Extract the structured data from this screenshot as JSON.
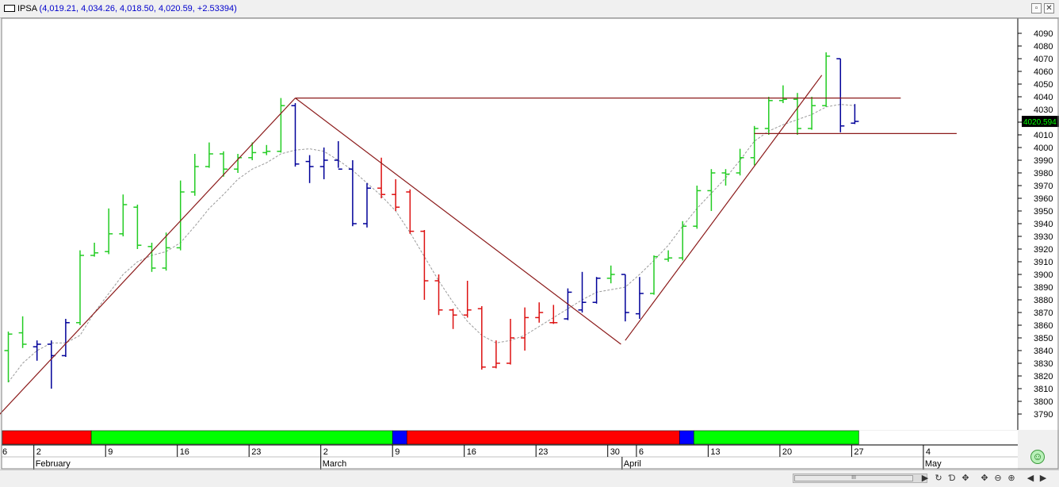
{
  "window": {
    "symbol": "IPSA",
    "quote": "(4,019.21, 4,034.26, 4,018.50, 4,020.59, +2.53394)",
    "restore_icon": "restore-icon",
    "close_icon": "close-icon"
  },
  "chart_data": {
    "type": "ohlc",
    "ylim": [
      3785,
      4100
    ],
    "yticks": [
      3790,
      3800,
      3810,
      3820,
      3830,
      3840,
      3850,
      3860,
      3870,
      3880,
      3890,
      3900,
      3910,
      3920,
      3930,
      3940,
      3950,
      3960,
      3970,
      3980,
      3990,
      4000,
      4010,
      4020,
      4030,
      4040,
      4050,
      4060,
      4070,
      4080,
      4090
    ],
    "last_price_label": "4020.594",
    "date_ticks": [
      {
        "i": 2,
        "label": "2"
      },
      {
        "i": 7,
        "label": "9"
      },
      {
        "i": 12,
        "label": "16"
      },
      {
        "i": 17,
        "label": "23"
      },
      {
        "i": 22,
        "label": "2"
      },
      {
        "i": 27,
        "label": "9"
      },
      {
        "i": 32,
        "label": "16"
      },
      {
        "i": 37,
        "label": "23"
      },
      {
        "i": 42,
        "label": "30"
      },
      {
        "i": 44,
        "label": "6"
      },
      {
        "i": 49,
        "label": "13"
      },
      {
        "i": 54,
        "label": "20"
      },
      {
        "i": 59,
        "label": "27"
      },
      {
        "i": 64,
        "label": "4"
      }
    ],
    "left_edge_label": "6",
    "months": [
      {
        "i": 2,
        "label": "February"
      },
      {
        "i": 22,
        "label": "March"
      },
      {
        "i": 43,
        "label": "April"
      },
      {
        "i": 64,
        "label": "May"
      }
    ],
    "colors": {
      "up": "#22cc22",
      "down": "#dd1111",
      "neutral": "#000099",
      "ma": "#9a9a9a",
      "trend": "#8b1a1a"
    },
    "bars": [
      {
        "o": 3840,
        "h": 3855,
        "l": 3815,
        "c": 3853,
        "s": "up"
      },
      {
        "o": 3854,
        "h": 3867,
        "l": 3842,
        "c": 3845,
        "s": "up"
      },
      {
        "o": 3843,
        "h": 3848,
        "l": 3832,
        "c": 3845,
        "s": "neutral"
      },
      {
        "o": 3845,
        "h": 3848,
        "l": 3810,
        "c": 3836,
        "s": "neutral"
      },
      {
        "o": 3836,
        "h": 3865,
        "l": 3835,
        "c": 3862,
        "s": "neutral"
      },
      {
        "o": 3862,
        "h": 3919,
        "l": 3860,
        "c": 3915,
        "s": "up"
      },
      {
        "o": 3915,
        "h": 3925,
        "l": 3914,
        "c": 3917,
        "s": "up"
      },
      {
        "o": 3918,
        "h": 3952,
        "l": 3916,
        "c": 3932,
        "s": "up"
      },
      {
        "o": 3932,
        "h": 3963,
        "l": 3930,
        "c": 3955,
        "s": "up"
      },
      {
        "o": 3953,
        "h": 3955,
        "l": 3920,
        "c": 3923,
        "s": "up"
      },
      {
        "o": 3922,
        "h": 3925,
        "l": 3902,
        "c": 3905,
        "s": "up"
      },
      {
        "o": 3905,
        "h": 3933,
        "l": 3903,
        "c": 3921,
        "s": "up"
      },
      {
        "o": 3921,
        "h": 3974,
        "l": 3919,
        "c": 3965,
        "s": "up"
      },
      {
        "o": 3965,
        "h": 3995,
        "l": 3962,
        "c": 3985,
        "s": "up"
      },
      {
        "o": 3985,
        "h": 4004,
        "l": 3984,
        "c": 3995,
        "s": "up"
      },
      {
        "o": 3995,
        "h": 3997,
        "l": 3977,
        "c": 3983,
        "s": "up"
      },
      {
        "o": 3983,
        "h": 3995,
        "l": 3980,
        "c": 3992,
        "s": "up"
      },
      {
        "o": 3992,
        "h": 4004,
        "l": 3990,
        "c": 3996,
        "s": "up"
      },
      {
        "o": 3996,
        "h": 4002,
        "l": 3994,
        "c": 3997,
        "s": "up"
      },
      {
        "o": 3997,
        "h": 4039,
        "l": 3996,
        "c": 4033,
        "s": "up"
      },
      {
        "o": 4033,
        "h": 4035,
        "l": 3985,
        "c": 3987,
        "s": "neutral"
      },
      {
        "o": 3989,
        "h": 3994,
        "l": 3972,
        "c": 3985,
        "s": "neutral"
      },
      {
        "o": 3985,
        "h": 4000,
        "l": 3975,
        "c": 3990,
        "s": "neutral"
      },
      {
        "o": 3990,
        "h": 4005,
        "l": 3984,
        "c": 3983,
        "s": "neutral"
      },
      {
        "o": 3983,
        "h": 3990,
        "l": 3938,
        "c": 3940,
        "s": "neutral"
      },
      {
        "o": 3940,
        "h": 3972,
        "l": 3937,
        "c": 3968,
        "s": "neutral"
      },
      {
        "o": 3968,
        "h": 3992,
        "l": 3960,
        "c": 3963,
        "s": "down"
      },
      {
        "o": 3963,
        "h": 3975,
        "l": 3950,
        "c": 3953,
        "s": "down"
      },
      {
        "o": 3965,
        "h": 3967,
        "l": 3932,
        "c": 3934,
        "s": "down"
      },
      {
        "o": 3934,
        "h": 3935,
        "l": 3880,
        "c": 3895,
        "s": "down"
      },
      {
        "o": 3895,
        "h": 3900,
        "l": 3868,
        "c": 3872,
        "s": "down"
      },
      {
        "o": 3872,
        "h": 3873,
        "l": 3857,
        "c": 3868,
        "s": "down"
      },
      {
        "o": 3868,
        "h": 3895,
        "l": 3866,
        "c": 3872,
        "s": "down"
      },
      {
        "o": 3873,
        "h": 3875,
        "l": 3825,
        "c": 3827,
        "s": "down"
      },
      {
        "o": 3827,
        "h": 3848,
        "l": 3826,
        "c": 3830,
        "s": "down"
      },
      {
        "o": 3830,
        "h": 3865,
        "l": 3829,
        "c": 3850,
        "s": "down"
      },
      {
        "o": 3850,
        "h": 3874,
        "l": 3840,
        "c": 3866,
        "s": "down"
      },
      {
        "o": 3866,
        "h": 3878,
        "l": 3862,
        "c": 3870,
        "s": "down"
      },
      {
        "o": 3862,
        "h": 3876,
        "l": 3861,
        "c": 3862,
        "s": "down"
      },
      {
        "o": 3865,
        "h": 3889,
        "l": 3864,
        "c": 3886,
        "s": "neutral"
      },
      {
        "o": 3872,
        "h": 3902,
        "l": 3870,
        "c": 3878,
        "s": "neutral"
      },
      {
        "o": 3878,
        "h": 3898,
        "l": 3877,
        "c": 3897,
        "s": "neutral"
      },
      {
        "o": 3897,
        "h": 3907,
        "l": 3893,
        "c": 3900,
        "s": "up"
      },
      {
        "o": 3900,
        "h": 3900,
        "l": 3863,
        "c": 3870,
        "s": "neutral"
      },
      {
        "o": 3869,
        "h": 3898,
        "l": 3865,
        "c": 3885,
        "s": "neutral"
      },
      {
        "o": 3885,
        "h": 3915,
        "l": 3884,
        "c": 3914,
        "s": "up"
      },
      {
        "o": 3912,
        "h": 3919,
        "l": 3910,
        "c": 3913,
        "s": "up"
      },
      {
        "o": 3913,
        "h": 3942,
        "l": 3911,
        "c": 3938,
        "s": "up"
      },
      {
        "o": 3938,
        "h": 3970,
        "l": 3936,
        "c": 3966,
        "s": "up"
      },
      {
        "o": 3966,
        "h": 3983,
        "l": 3950,
        "c": 3980,
        "s": "up"
      },
      {
        "o": 3980,
        "h": 3983,
        "l": 3970,
        "c": 3979,
        "s": "up"
      },
      {
        "o": 3980,
        "h": 3999,
        "l": 3978,
        "c": 3992,
        "s": "up"
      },
      {
        "o": 3992,
        "h": 4017,
        "l": 3986,
        "c": 4015,
        "s": "up"
      },
      {
        "o": 4015,
        "h": 4040,
        "l": 4010,
        "c": 4037,
        "s": "up"
      },
      {
        "o": 4037,
        "h": 4049,
        "l": 4035,
        "c": 4038,
        "s": "up"
      },
      {
        "o": 4038,
        "h": 4043,
        "l": 4010,
        "c": 4015,
        "s": "up"
      },
      {
        "o": 4015,
        "h": 4040,
        "l": 4014,
        "c": 4033,
        "s": "up"
      },
      {
        "o": 4033,
        "h": 4075,
        "l": 4032,
        "c": 4072,
        "s": "up"
      },
      {
        "o": 4070,
        "h": 4070,
        "l": 4012,
        "c": 4017,
        "s": "neutral"
      },
      {
        "o": 4019.21,
        "h": 4034.26,
        "l": 4018.5,
        "c": 4020.59,
        "s": "neutral"
      }
    ],
    "ma": [
      3815,
      3830,
      3840,
      3846,
      3846,
      3852,
      3870,
      3885,
      3900,
      3910,
      3915,
      3918,
      3925,
      3938,
      3952,
      3963,
      3975,
      3983,
      3988,
      3995,
      3998,
      3999,
      3997,
      3990,
      3982,
      3972,
      3962,
      3950,
      3933,
      3914,
      3895,
      3878,
      3863,
      3852,
      3846,
      3848,
      3852,
      3859,
      3866,
      3873,
      3880,
      3886,
      3888,
      3890,
      3900,
      3911,
      3923,
      3938,
      3952,
      3964,
      3976,
      3990,
      4005,
      4013,
      4018,
      4022,
      4026,
      4032,
      4034,
      4033
    ],
    "trendlines": [
      {
        "i1": -1,
        "v1": 3785,
        "i2": 20,
        "v2": 4039
      },
      {
        "i1": 20,
        "v1": 4039,
        "i2": 42.7,
        "v2": 3845
      },
      {
        "i1": 43,
        "v1": 3848,
        "i2": 56.7,
        "v2": 4057
      },
      {
        "i1": 20,
        "v1": 4039,
        "i2": 62.2,
        "v2": 4039
      },
      {
        "i1": 52,
        "v1": 4011,
        "i2": 66.1,
        "v2": 4011
      }
    ],
    "regime_bands": [
      {
        "from": 0,
        "to": 6,
        "color": "#ff0000"
      },
      {
        "from": 6,
        "to": 27,
        "color": "#00ff00"
      },
      {
        "from": 27,
        "to": 28,
        "color": "#0000ff"
      },
      {
        "from": 28,
        "to": 47,
        "color": "#ff0000"
      },
      {
        "from": 47,
        "to": 48,
        "color": "#0000ff"
      },
      {
        "from": 48,
        "to": 59.5,
        "color": "#00ff00"
      }
    ]
  },
  "bottom": {
    "scroll_grip": "III",
    "buttons": [
      "↻",
      "Ɗ",
      "✥",
      "⊖",
      "⊕",
      "◀",
      "▶",
      "◀",
      "▶"
    ]
  }
}
